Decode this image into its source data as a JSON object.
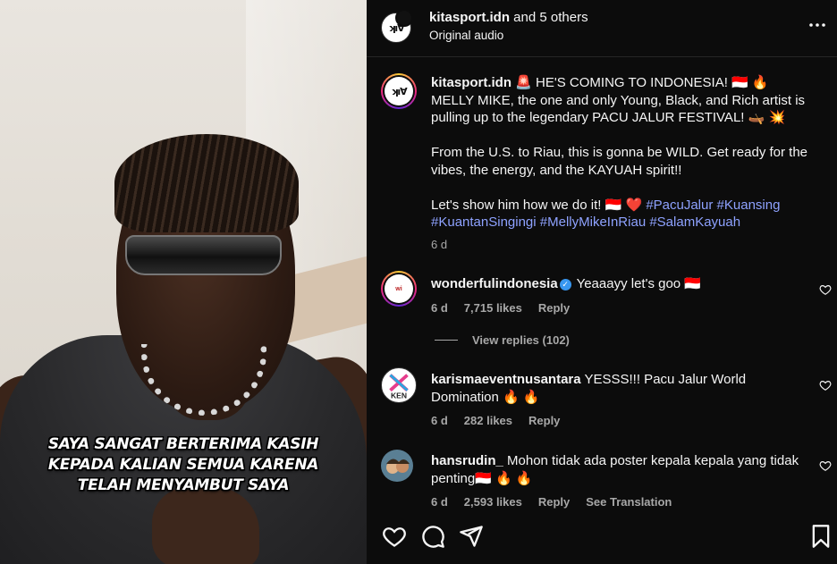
{
  "video": {
    "caption_lines": [
      "SAYA SANGAT BERTERIMA KASIH",
      "KEPADA KALIAN SEMUA KARENA",
      "TELAH MENYAMBUT SAYA"
    ]
  },
  "header": {
    "username": "kitasport.idn",
    "collab_text": " and 5 others",
    "audio": "Original audio",
    "more_icon": "more-horizontal-icon"
  },
  "post": {
    "username": "kitasport.idn",
    "line1": " 🚨 HE'S COMING TO INDONESIA! 🇮🇩 🔥",
    "line2": "MELLY MIKE, the one and only Young, Black, and Rich artist is pulling up to the legendary PACU JALUR FESTIVAL! 🛶 💥",
    "line3": "From the U.S. to Riau, this is gonna be WILD. Get ready for the vibes, the energy, and the KAYUAH spirit!!",
    "line4": "Let's show him how we do it! 🇮🇩 ❤️ ",
    "hashtags": [
      "#PacuJalur",
      "#Kuansing",
      "#KuantanSingingi",
      "#MellyMikeInRiau",
      "#SalamKayuah"
    ],
    "time": "6 d"
  },
  "comments": [
    {
      "username": "wonderfulindonesia",
      "verified": true,
      "text": " Yeaaayy let's goo 🇮🇩",
      "time": "6 d",
      "likes": "7,715 likes",
      "reply": "Reply",
      "replies_label": "View replies (102)"
    },
    {
      "username": "karismaeventnusantara",
      "text": " YESSS!!! Pacu Jalur World Domination 🔥 🔥",
      "time": "6 d",
      "likes": "282 likes",
      "reply": "Reply",
      "avatar_text": "KEN"
    },
    {
      "username": "hansrudin_",
      "text": " Mohon tidak ada poster kepala kepala yang tidak penting🇮🇩 🔥 🔥",
      "time": "6 d",
      "likes": "2,593 likes",
      "reply": "Reply",
      "translate": "See Translation"
    }
  ],
  "actions": [
    "like-icon",
    "comment-icon",
    "share-icon",
    "save-icon"
  ],
  "colors": {
    "panel_bg": "#0c0c0c",
    "hashtag": "#8ea2ff",
    "muted": "#a8a8a8",
    "verified": "#3897f0"
  }
}
